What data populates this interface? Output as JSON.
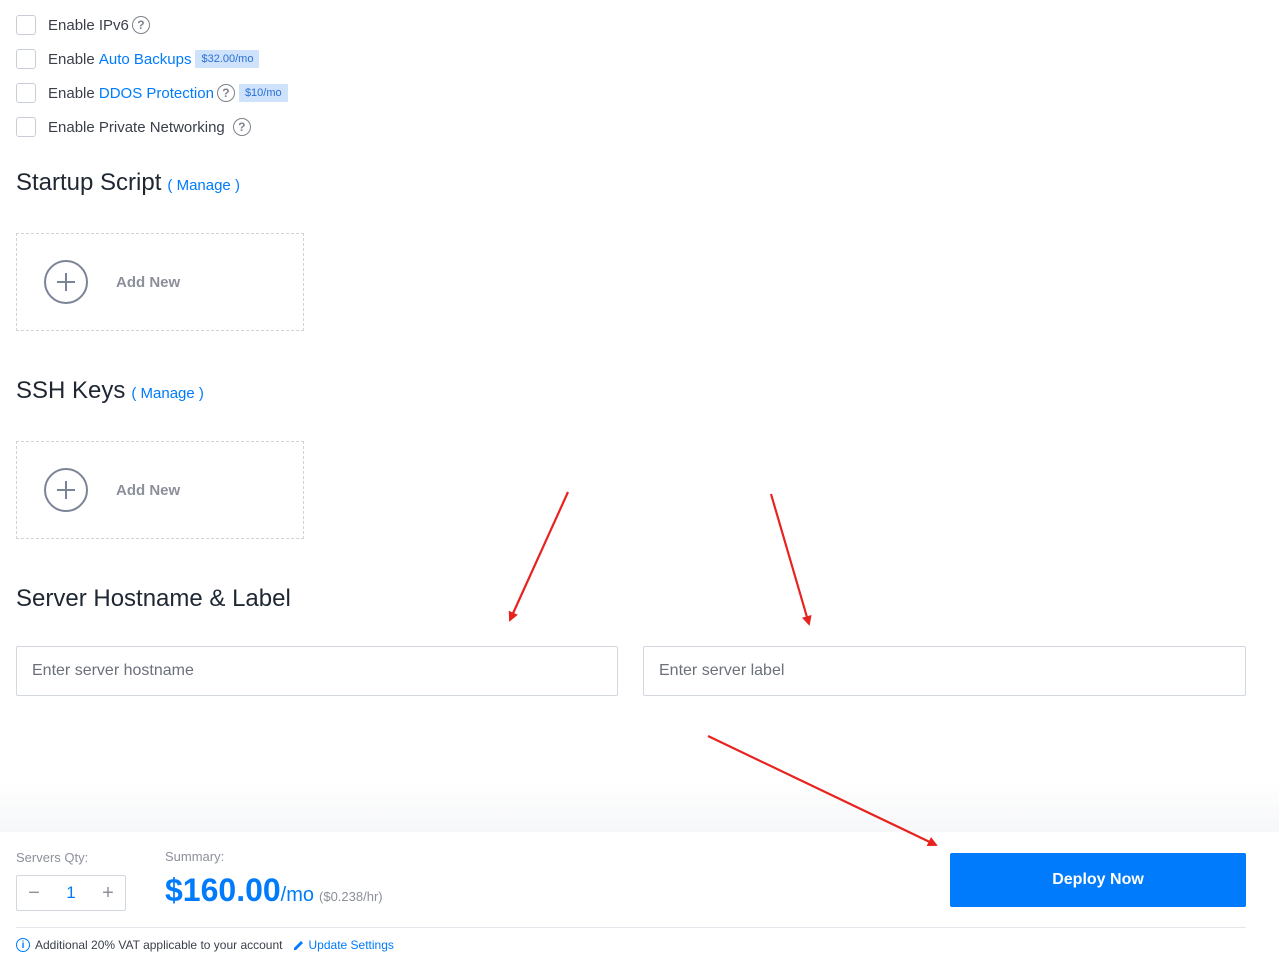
{
  "options": {
    "ipv6": {
      "prefix": "Enable IPv6"
    },
    "backups": {
      "prefix": "Enable",
      "link": "Auto Backups",
      "badge": "$32.00/mo"
    },
    "ddos": {
      "prefix": "Enable",
      "link": "DDOS Protection",
      "badge": "$10/mo"
    },
    "private_net": {
      "prefix": "Enable Private Networking"
    },
    "help_glyph": "?"
  },
  "startup_script": {
    "title": "Startup Script",
    "manage": "( Manage )",
    "add_label": "Add New"
  },
  "ssh_keys": {
    "title": "SSH Keys",
    "manage": "( Manage )",
    "add_label": "Add New"
  },
  "server": {
    "title": "Server Hostname & Label",
    "hostname_placeholder": "Enter server hostname",
    "label_placeholder": "Enter server label"
  },
  "footer": {
    "qty_label": "Servers Qty:",
    "qty_value": "1",
    "minus": "−",
    "plus": "+",
    "summary_label": "Summary:",
    "price": "$160.00",
    "per_month": "/mo",
    "hourly": "($0.238/hr)",
    "deploy_label": "Deploy Now",
    "vat_note": "Additional 20% VAT applicable to your account",
    "update_settings": "Update Settings",
    "info_glyph": "i"
  },
  "colors": {
    "accent": "#007bfc",
    "annotation_arrow": "#e8231f",
    "badge_bg": "#cfe2fb"
  },
  "icons": [
    "help-icon",
    "plus-circle-icon",
    "info-icon",
    "pencil-icon",
    "annotation-arrow"
  ]
}
